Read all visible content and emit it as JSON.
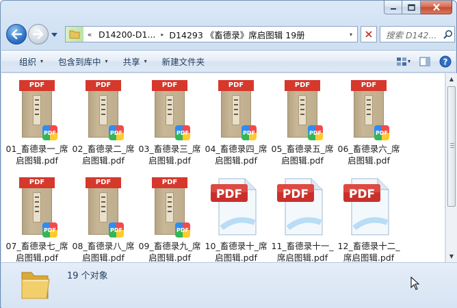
{
  "window": {
    "caption_buttons": [
      "minimize-icon",
      "maximize-icon",
      "close-icon"
    ]
  },
  "address_bar": {
    "overflow_chevron": "«",
    "crumbs": [
      "D14200-D1...",
      "D14293 《畜德录》席启图辑 19册"
    ],
    "crumb_separator": "▸",
    "dropdown": "▾"
  },
  "search": {
    "placeholder": "搜索 D142..."
  },
  "toolbar": {
    "items": [
      {
        "label": "组织",
        "caret": "▾"
      },
      {
        "label": "包含到库中",
        "caret": "▾"
      },
      {
        "label": "共享",
        "caret": "▾"
      },
      {
        "label": "新建文件夹",
        "caret": ""
      }
    ],
    "view_caret": "▾"
  },
  "thumb_badge": "PDF",
  "book_tag": "PDF",
  "files": [
    {
      "label": "01_畜德录一_席启图辑.pdf",
      "kind": "book"
    },
    {
      "label": "02_畜德录二_席启图辑.pdf",
      "kind": "book"
    },
    {
      "label": "03_畜德录三_席启图辑.pdf",
      "kind": "book"
    },
    {
      "label": "04_畜德录四_席启图辑.pdf",
      "kind": "book"
    },
    {
      "label": "05_畜德录五_席启图辑.pdf",
      "kind": "book"
    },
    {
      "label": "06_畜德录六_席启图辑.pdf",
      "kind": "book"
    },
    {
      "label": "07_畜德录七_席启图辑.pdf",
      "kind": "book"
    },
    {
      "label": "08_畜德录八_席启图辑.pdf",
      "kind": "book"
    },
    {
      "label": "09_畜德录九_席启图辑.pdf",
      "kind": "book"
    },
    {
      "label": "10_畜德录十_席启图辑.pdf",
      "kind": "pdf"
    },
    {
      "label": "11_畜德录十一_席启图辑.pdf",
      "kind": "pdf"
    },
    {
      "label": "12_畜德录十二_席启图辑.pdf",
      "kind": "pdf"
    }
  ],
  "scrollbar": {
    "up": "▲",
    "down": "▼"
  },
  "status": {
    "count_text": "19 个对象"
  },
  "colors": {
    "pdf_red": "#d6382c",
    "accent": "#1e395b"
  }
}
